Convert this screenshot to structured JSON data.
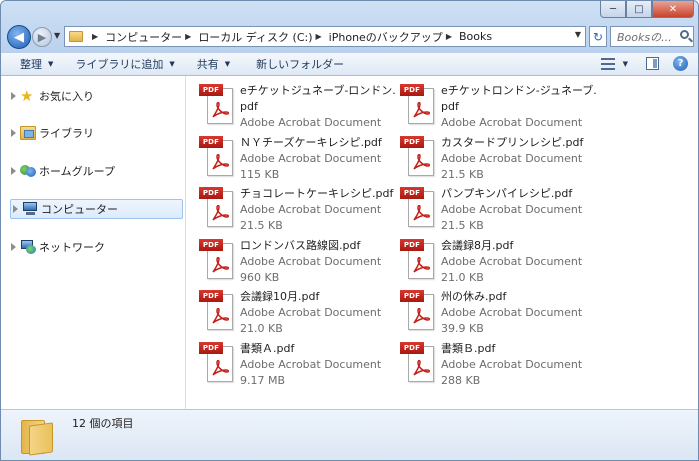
{
  "window": {
    "controls": {
      "minimize": "─",
      "maximize": "□",
      "close": "✕"
    }
  },
  "address": {
    "crumbs": [
      "コンピューター",
      "ローカル ディスク (C:)",
      "iPhoneのバックアップ",
      "Books"
    ]
  },
  "search": {
    "placeholder": "Booksの..."
  },
  "toolbar": {
    "organize": "整理",
    "add_to_library": "ライブラリに追加",
    "share": "共有",
    "new_folder": "新しいフォルダー"
  },
  "navigation": {
    "favorites": "お気に入り",
    "libraries": "ライブラリ",
    "homegroup": "ホームグループ",
    "computer": "コンピューター",
    "network": "ネットワーク"
  },
  "files": [
    {
      "name": "eチケットジュネーブ-ロンドン.\npdf",
      "type": "Adobe Acrobat Document",
      "size": ""
    },
    {
      "name": "eチケットロンドン-ジュネーブ.\npdf",
      "type": "Adobe Acrobat Document",
      "size": ""
    },
    {
      "name": "ＮＹチーズケーキレシピ.pdf",
      "type": "Adobe Acrobat Document",
      "size": "115 KB"
    },
    {
      "name": "カスタードプリンレシピ.pdf",
      "type": "Adobe Acrobat Document",
      "size": "21.5 KB"
    },
    {
      "name": "チョコレートケーキレシピ.pdf",
      "type": "Adobe Acrobat Document",
      "size": "21.5 KB"
    },
    {
      "name": "パンプキンパイレシピ.pdf",
      "type": "Adobe Acrobat Document",
      "size": "21.5 KB"
    },
    {
      "name": "ロンドンバス路線図.pdf",
      "type": "Adobe Acrobat Document",
      "size": "960 KB"
    },
    {
      "name": "会議録8月.pdf",
      "type": "Adobe Acrobat Document",
      "size": "21.0 KB"
    },
    {
      "name": "会議録10月.pdf",
      "type": "Adobe Acrobat Document",
      "size": "21.0 KB"
    },
    {
      "name": "州の休み.pdf",
      "type": "Adobe Acrobat Document",
      "size": "39.9 KB"
    },
    {
      "name": "書類Ａ.pdf",
      "type": "Adobe Acrobat Document",
      "size": "9.17 MB"
    },
    {
      "name": "書類Ｂ.pdf",
      "type": "Adobe Acrobat Document",
      "size": "288 KB"
    }
  ],
  "file_icon_label": "PDF",
  "details": {
    "item_count": "12 個の項目"
  }
}
